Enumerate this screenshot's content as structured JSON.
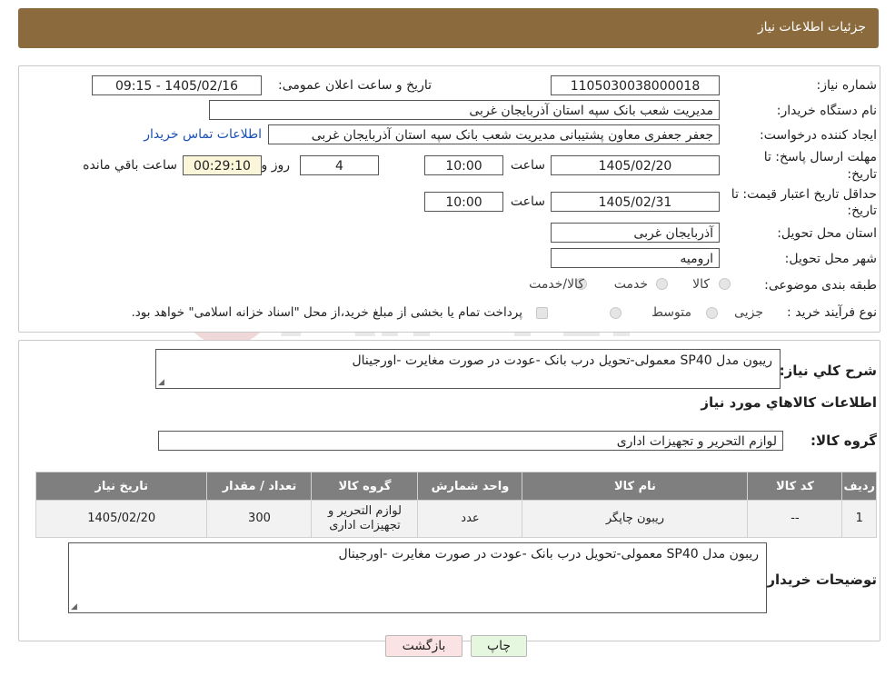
{
  "header": {
    "title": "جزئیات اطلاعات نیاز"
  },
  "form": {
    "need_number_label": "شماره نیاز:",
    "need_number": "1105030038000018",
    "announce_label": "تاریخ و ساعت اعلان عمومی:",
    "announce_value": "1405/02/16 - 09:15",
    "buyer_org_label": "نام دستگاه خریدار:",
    "buyer_org": "مدیریت شعب بانک سپه استان آذربایجان غربی",
    "creator_label": "ایجاد کننده درخواست:",
    "creator": "جعفر جعفری معاون پشتیبانی مدیریت شعب بانک سپه استان آذربایجان غربی",
    "contact_link": "اطلاعات تماس خریدار",
    "deadline_label_1": "مهلت ارسال پاسخ: تا",
    "deadline_label_2": "تاریخ:",
    "deadline_date": "1405/02/20",
    "time_label": "ساعت",
    "deadline_time": "10:00",
    "days_value": "4",
    "days_label": "روز و",
    "remaining_time": "00:29:10",
    "remaining_label": "ساعت باقي مانده",
    "validity_label_1": "حداقل تاریخ اعتبار قیمت: تا",
    "validity_label_2": "تاریخ:",
    "validity_date": "1405/02/31",
    "validity_time": "10:00",
    "province_label": "استان محل تحویل:",
    "province": "آذربایجان غربی",
    "city_label": "شهر محل تحویل:",
    "city": "ارومیه",
    "category_label": "طبقه بندی موضوعی:",
    "category_options": [
      "کالا",
      "خدمت",
      "کالا/خدمت"
    ],
    "process_label": "نوع فرآیند خرید :",
    "process_options": [
      "جزیی",
      "متوسط"
    ],
    "process_note": "پرداخت تمام یا بخشی از مبلغ خرید،از محل \"اسناد خزانه اسلامی\" خواهد بود."
  },
  "summary": {
    "label": "شرح کلي نياز:",
    "text": "ریبون مدل SP40 معمولی-تحویل درب بانک -عودت در صورت مغایرت -اورجینال",
    "goods_info_title": "اطلاعات کالاهاي مورد نياز",
    "group_label": "گروه کالا:",
    "group_value": "لوازم التحریر و تجهیزات اداری"
  },
  "table": {
    "headers": [
      "ردیف",
      "کد کالا",
      "نام کالا",
      "واحد شمارش",
      "گروه کالا",
      "تعداد / مقدار",
      "تاریخ نیاز"
    ],
    "rows": [
      [
        "1",
        "--",
        "ریبون چاپگر",
        "عدد",
        "لوازم التحریر و تجهیزات اداری",
        "300",
        "1405/02/20"
      ]
    ]
  },
  "buyer_notes": {
    "label": "توضیحات خریدار:",
    "text": "ریبون مدل SP40 معمولی-تحویل درب بانک -عودت در صورت مغایرت -اورجینال"
  },
  "buttons": {
    "back": "بازگشت",
    "print": "چاپ"
  },
  "colors": {
    "header_bg": "#8b6b3d",
    "table_header_bg": "#7f7f7f",
    "link": "#1a4fb5",
    "back_btn_bg": "#fbe3e3",
    "print_btn_bg": "#e6f7df"
  }
}
